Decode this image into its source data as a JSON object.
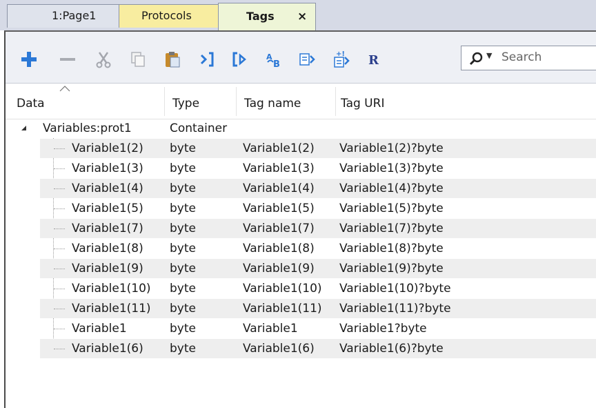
{
  "tabs": [
    {
      "label": "1:Page1"
    },
    {
      "label": "Protocols"
    },
    {
      "label": "Tags",
      "close": "×"
    }
  ],
  "toolbar": {
    "buttons": [
      {
        "icon": "add-icon"
      },
      {
        "icon": "remove-icon"
      },
      {
        "icon": "cut-icon"
      },
      {
        "icon": "copy-icon"
      },
      {
        "icon": "paste-icon"
      },
      {
        "icon": "import-icon"
      },
      {
        "icon": "export-icon"
      },
      {
        "icon": "tag-rename-icon"
      },
      {
        "icon": "dictionary-icon"
      },
      {
        "icon": "add-dictionary-icon"
      },
      {
        "icon": "bold-r-icon"
      }
    ],
    "search_placeholder": "Search"
  },
  "columns": {
    "data": "Data",
    "type": "Type",
    "tag_name": "Tag name",
    "tag_uri": "Tag URI"
  },
  "container": {
    "label": "Variables:prot1",
    "type": "Container"
  },
  "rows": [
    {
      "data": "Variable1(2)",
      "type": "byte",
      "tag_name": "Variable1(2)",
      "tag_uri": "Variable1(2)?byte"
    },
    {
      "data": "Variable1(3)",
      "type": "byte",
      "tag_name": "Variable1(3)",
      "tag_uri": "Variable1(3)?byte"
    },
    {
      "data": "Variable1(4)",
      "type": "byte",
      "tag_name": "Variable1(4)",
      "tag_uri": "Variable1(4)?byte"
    },
    {
      "data": "Variable1(5)",
      "type": "byte",
      "tag_name": "Variable1(5)",
      "tag_uri": "Variable1(5)?byte"
    },
    {
      "data": "Variable1(7)",
      "type": "byte",
      "tag_name": "Variable1(7)",
      "tag_uri": "Variable1(7)?byte"
    },
    {
      "data": "Variable1(8)",
      "type": "byte",
      "tag_name": "Variable1(8)",
      "tag_uri": "Variable1(8)?byte"
    },
    {
      "data": "Variable1(9)",
      "type": "byte",
      "tag_name": "Variable1(9)",
      "tag_uri": "Variable1(9)?byte"
    },
    {
      "data": "Variable1(10)",
      "type": "byte",
      "tag_name": "Variable1(10)",
      "tag_uri": "Variable1(10)?byte"
    },
    {
      "data": "Variable1(11)",
      "type": "byte",
      "tag_name": "Variable1(11)",
      "tag_uri": "Variable1(11)?byte"
    },
    {
      "data": "Variable1",
      "type": "byte",
      "tag_name": "Variable1",
      "tag_uri": "Variable1?byte"
    },
    {
      "data": "Variable1(6)",
      "type": "byte",
      "tag_name": "Variable1(6)",
      "tag_uri": "Variable1(6)?byte"
    }
  ],
  "colors": {
    "accent_blue": "#2b78d6",
    "protocols_tab": "#f8eda0",
    "tags_tab": "#eef5d7",
    "row_stripe": "#eeeeee"
  }
}
